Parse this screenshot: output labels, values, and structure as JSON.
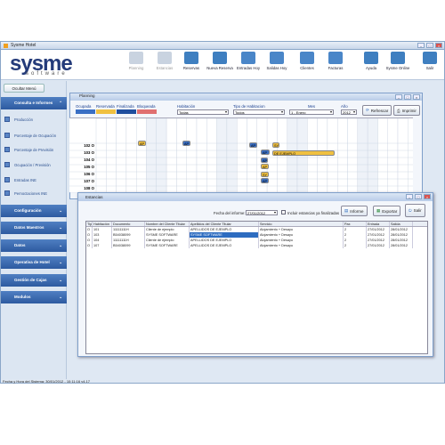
{
  "window": {
    "title": "Sysme Hotel"
  },
  "logo": {
    "name": "sysme",
    "sub": "software"
  },
  "toolbar": {
    "buttons": [
      {
        "label": "Planning",
        "disabled": true,
        "color": "#c9d3e0"
      },
      {
        "label": "Estancias",
        "disabled": true,
        "color": "#c9d3e0"
      },
      {
        "label": "Reservas",
        "disabled": false,
        "color": "#3f7fc0"
      },
      {
        "label": "Nueva Reserva",
        "disabled": false,
        "color": "#3f7fc0"
      },
      {
        "label": "Entradas Hoy",
        "disabled": false,
        "color": "#4a86c8"
      },
      {
        "label": "Salidas Hoy",
        "disabled": false,
        "color": "#4a86c8"
      },
      {
        "label": "Clientes",
        "disabled": false,
        "color": "#4a86c8"
      },
      {
        "label": "Facturas",
        "disabled": false,
        "color": "#4a86c8"
      },
      {
        "label": "Ayuda",
        "disabled": false,
        "color": "#3f7fc0"
      },
      {
        "label": "Sysme Online",
        "disabled": false,
        "color": "#3f7fc0"
      },
      {
        "label": "Salir",
        "disabled": false,
        "color": "#3f7fc0"
      }
    ]
  },
  "sidebar": {
    "hide_label": "Ocultar Menú",
    "sections": [
      {
        "label": "Consulta e Informes"
      },
      {
        "label": "Configuración"
      },
      {
        "label": "Datos Maestros"
      },
      {
        "label": "Datos"
      },
      {
        "label": "Operativa de Hotel"
      },
      {
        "label": "Gestión de Cajas"
      },
      {
        "label": "Modulos"
      }
    ],
    "items": [
      {
        "label": "Producción"
      },
      {
        "label": "Porcentaje de Ocupación"
      },
      {
        "label": "Porcentaje de Previsión"
      },
      {
        "label": "Ocupación / Previsión"
      },
      {
        "label": "Entradas INE"
      },
      {
        "label": "Pernoctaciones INE"
      }
    ]
  },
  "planning": {
    "title": "Planning",
    "legend": [
      {
        "label": "Ocupada",
        "color": "#3a6fc4"
      },
      {
        "label": "Reservada",
        "color": "#f0c040"
      },
      {
        "label": "Finalizada",
        "color": "#1f4e9e"
      },
      {
        "label": "Bloqueada",
        "color": "#e07070"
      }
    ],
    "habitacion_label": "Habitación",
    "habitacion_value": "Todas",
    "tipo_label": "Tipo de Habitacion",
    "tipo_value": "Todos",
    "mes_label": "Mes",
    "mes_value": "1 - Enero",
    "ano_label": "Año",
    "ano_value": "2012",
    "refresh_label": "Refrescar",
    "print_label": "Imprimir",
    "rooms": [
      "102 O",
      "103 O",
      "104 O",
      "105 O",
      "106 O",
      "107 O",
      "108 O"
    ],
    "bars": [
      {
        "text": "AP",
        "color": "#f0c040"
      },
      {
        "text": "AP",
        "color": "#3a6fc4"
      },
      {
        "text": "AP",
        "color": "#3a6fc4"
      },
      {
        "text": "SY",
        "color": "#f0c040"
      },
      {
        "text": "DE EJEMPLO",
        "color": "#f0c040"
      },
      {
        "text": "AP",
        "color": "#3a6fc4"
      },
      {
        "text": "AP",
        "color": "#3a6fc4"
      },
      {
        "text": "AP",
        "color": "#f0c040"
      },
      {
        "text": "SY",
        "color": "#f0c040"
      },
      {
        "text": "AP",
        "color": "#3a6fc4"
      }
    ]
  },
  "estancias": {
    "title": "Estancias",
    "fecha_label": "Fecha del informe:",
    "fecha_value": "27/01/2012",
    "check_label": "Incluir estancias ya finalizadas",
    "informe_label": "Informe",
    "exportar_label": "Exportar",
    "salir_label": "Salir",
    "columns": [
      "Tipo",
      "Habitación",
      "Documento",
      "Nombre del Cliente Titular",
      "Apellidos del Cliente Titular",
      "Servicio",
      "Pax",
      "Entrada",
      "Salida"
    ],
    "rows": [
      [
        "O",
        "101",
        "11111111H",
        "Cliente de ejemplo",
        "APELLIDOS DE EJEMPLO",
        "Alojamiento + Desayu",
        "2",
        "27/01/2012",
        "28/01/2012"
      ],
      [
        "O",
        "103",
        "B54038099",
        "SYSME SOFTWARE",
        "SYSME SOFTWARE",
        "Alojamiento + Desayu",
        "2",
        "27/01/2012",
        "28/01/2012"
      ],
      [
        "O",
        "104",
        "11111111H",
        "Cliente de ejemplo",
        "APELLIDOS DE EJEMPLO",
        "Alojamiento + Desayu",
        "2",
        "27/01/2012",
        "28/01/2012"
      ],
      [
        "O",
        "107",
        "B54038099",
        "SYSME SOFTWARE",
        "APELLIDOS DE EJEMPLO",
        "Alojamiento + Desayu",
        "2",
        "27/01/2012",
        "28/01/2012"
      ]
    ]
  },
  "status": {
    "text": "Fecha y Hora del Sistema: 30/01/2012 - 10:11:16 v4.17"
  }
}
